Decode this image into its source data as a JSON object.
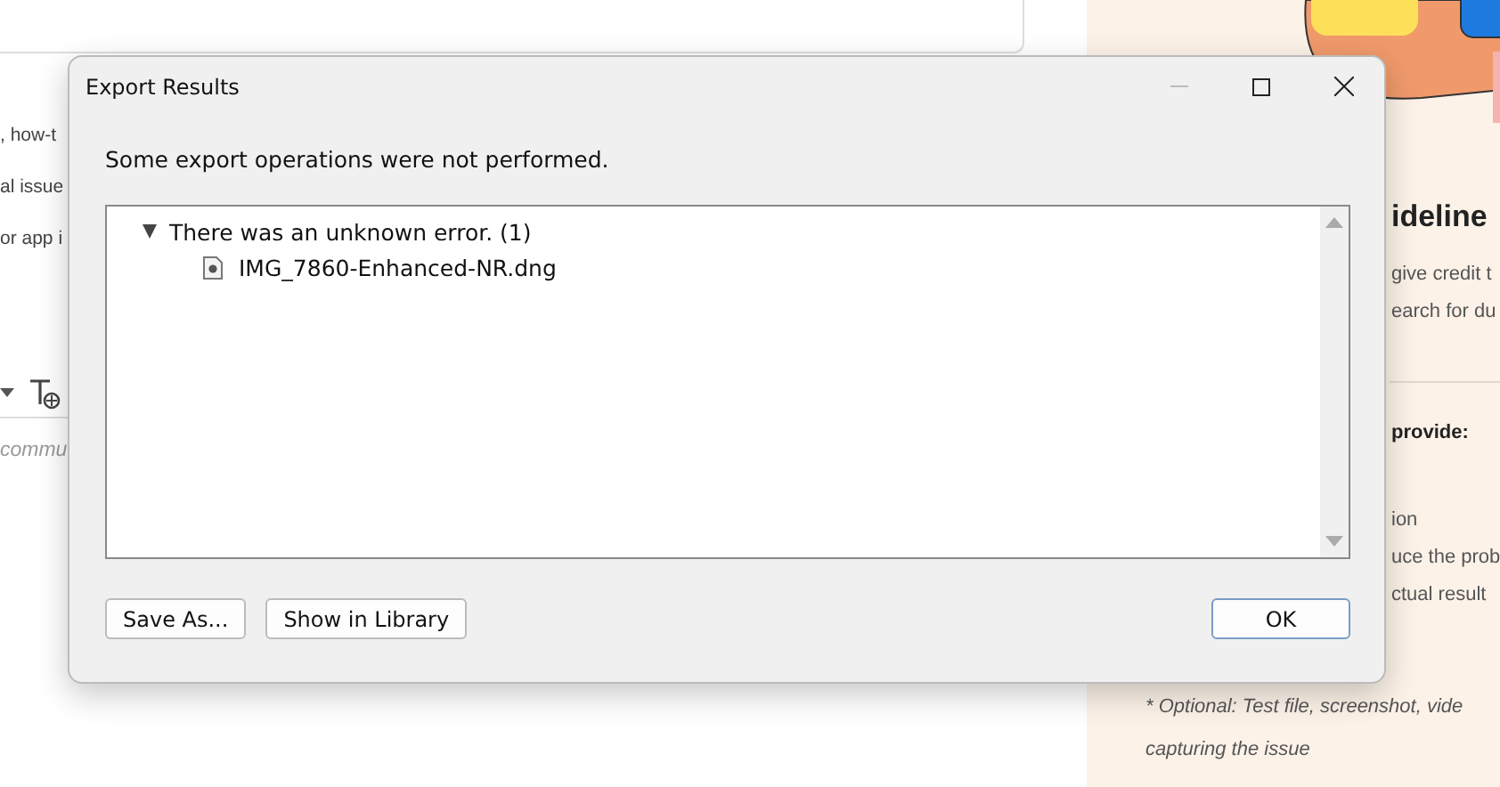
{
  "background_page": {
    "left_fragments": [
      ", how-t",
      "al issue",
      "or app i"
    ],
    "comment_placeholder": "commu",
    "guidelines": {
      "heading_fragment": "ideline",
      "intro_fragments": [
        "give credit t",
        "earch for du"
      ],
      "provide_fragment": "provide:",
      "list_fragments": [
        "ion",
        "uce the prob",
        "ctual result"
      ],
      "optional_note": "* Optional: Test file, screenshot, vide",
      "optional_note_end": "capturing the issue"
    }
  },
  "dialog": {
    "title": "Export Results",
    "message": "Some export operations were not performed.",
    "results": [
      {
        "label": "There was an unknown error. (1)",
        "expanded": true,
        "children": [
          {
            "label": "IMG_7860-Enhanced-NR.dng"
          }
        ]
      }
    ],
    "buttons": [
      {
        "label": "Save As...",
        "default": false
      },
      {
        "label": "Show in Library",
        "default": false
      },
      {
        "label": "OK",
        "default": true
      }
    ]
  }
}
